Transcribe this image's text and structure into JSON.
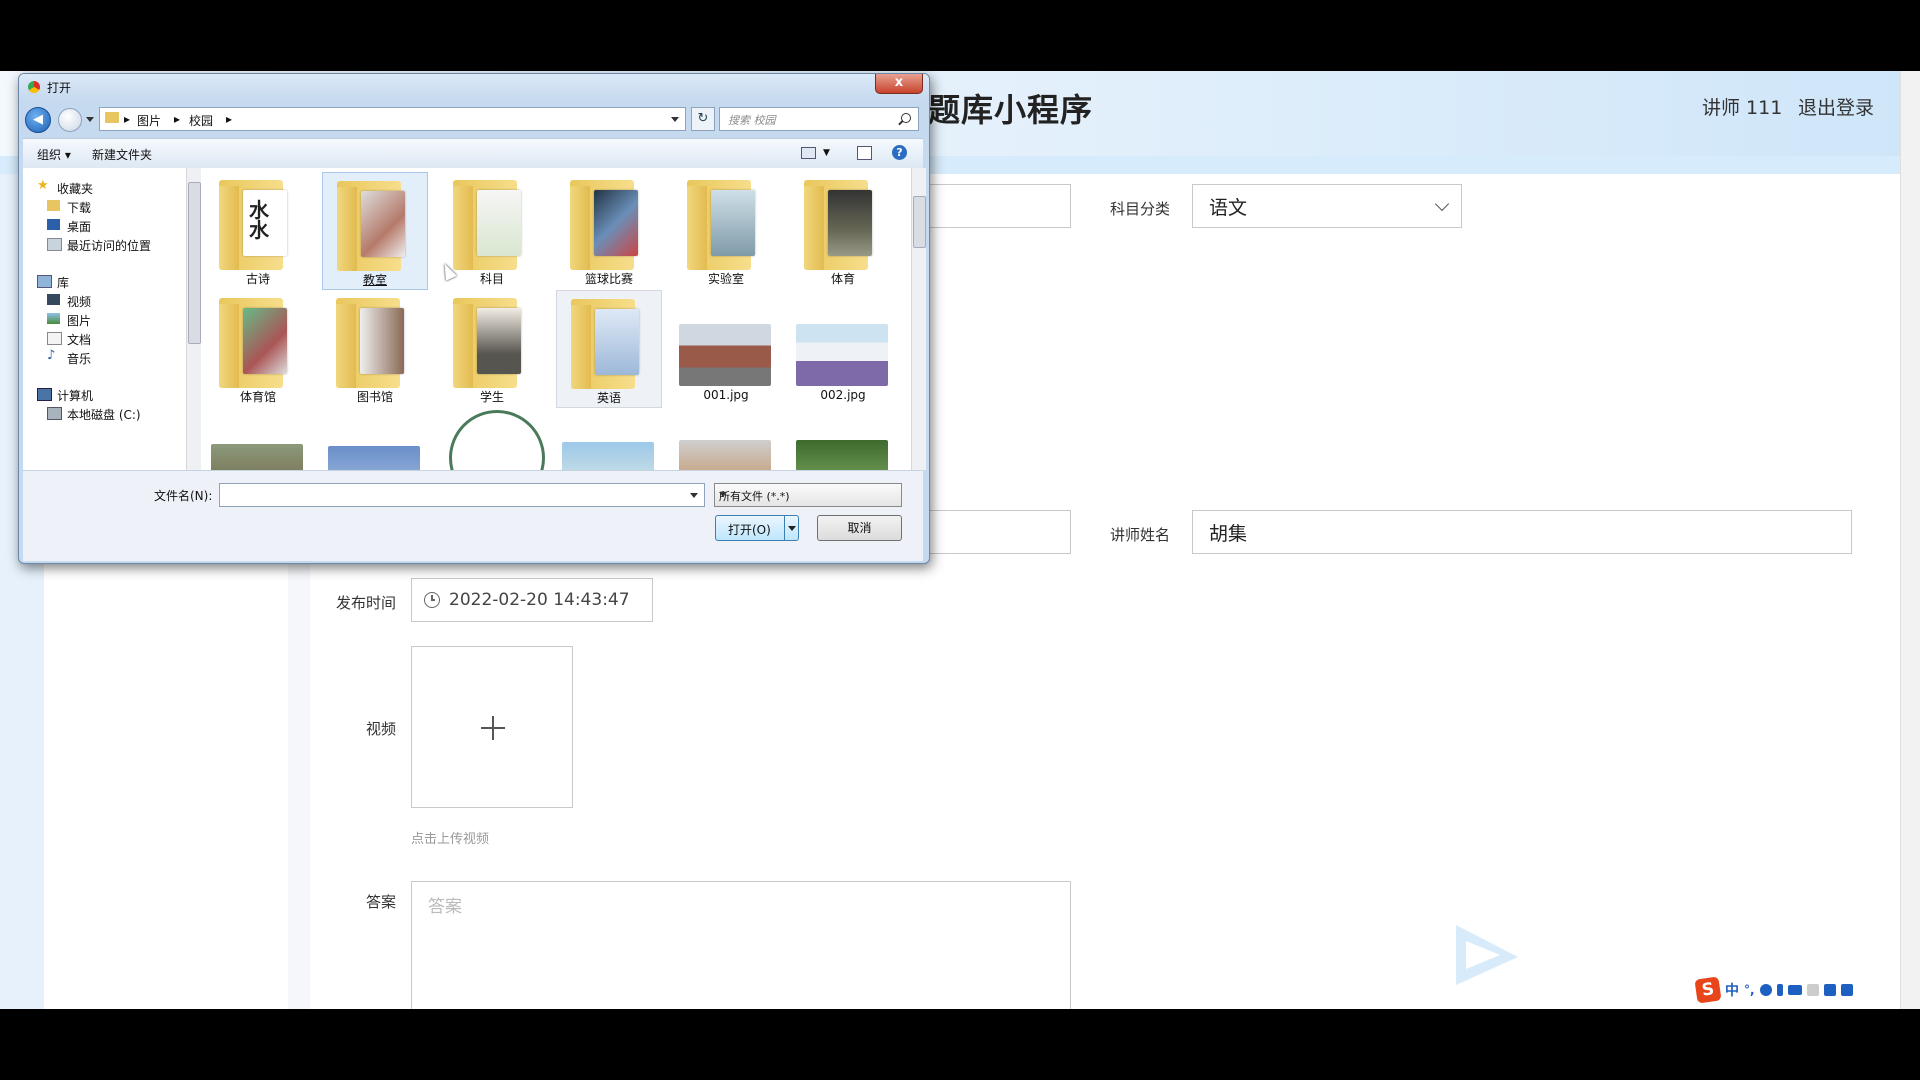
{
  "app": {
    "title": "题库小程序",
    "user": "讲师 111",
    "logout": "退出登录"
  },
  "form": {
    "subject_label": "科目分类",
    "subject_value": "语文",
    "teacher_label": "讲师姓名",
    "teacher_value": "胡集",
    "publish_label": "发布时间",
    "publish_value": "2022-02-20 14:43:47",
    "video_label": "视频",
    "upload_hint": "点击上传视频",
    "answer_label": "答案",
    "answer_placeholder": "答案"
  },
  "dialog": {
    "title": "打开",
    "close": "x",
    "breadcrumbs": [
      "图片",
      "校园"
    ],
    "search_placeholder": "搜索 校园",
    "toolbar": {
      "organize": "组织 ▾",
      "new_folder": "新建文件夹",
      "help": "?"
    },
    "nav": {
      "favorites": "收藏夹",
      "downloads": "下载",
      "desktop": "桌面",
      "recent": "最近访问的位置",
      "libraries": "库",
      "videos": "视频",
      "pictures": "图片",
      "documents": "文档",
      "music": "音乐",
      "computer": "计算机",
      "local_disk": "本地磁盘 (C:)"
    },
    "items": [
      {
        "name": "古诗",
        "kind": "folder"
      },
      {
        "name": "教室",
        "kind": "folder"
      },
      {
        "name": "科目",
        "kind": "folder"
      },
      {
        "name": "篮球比赛",
        "kind": "folder"
      },
      {
        "name": "实验室",
        "kind": "folder"
      },
      {
        "name": "体育",
        "kind": "folder"
      },
      {
        "name": "体育馆",
        "kind": "folder"
      },
      {
        "name": "图书馆",
        "kind": "folder"
      },
      {
        "name": "学生",
        "kind": "folder"
      },
      {
        "name": "英语",
        "kind": "folder"
      },
      {
        "name": "001.jpg",
        "kind": "image"
      },
      {
        "name": "002.jpg",
        "kind": "image"
      }
    ],
    "filename_label": "文件名(N):",
    "filename_value": "",
    "filter": "所有文件 (*.*)",
    "open_button": "打开(O)",
    "cancel_button": "取消"
  },
  "ime": {
    "brand": "S",
    "mode": "中",
    "punct": "°,"
  }
}
